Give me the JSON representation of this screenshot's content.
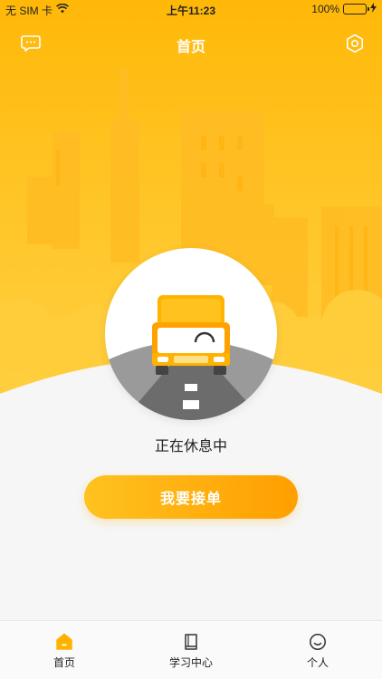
{
  "status_bar": {
    "carrier": "无 SIM 卡",
    "time": "上午11:23",
    "battery": "100%"
  },
  "nav": {
    "title": "首页",
    "left_icon": "message-icon",
    "right_icon": "settings-icon"
  },
  "main": {
    "status_text": "正在休息中",
    "order_button": "我要接单"
  },
  "tabs": [
    {
      "label": "首页",
      "icon": "home-icon",
      "active": true
    },
    {
      "label": "学习中心",
      "icon": "book-icon",
      "active": false
    },
    {
      "label": "个人",
      "icon": "smile-icon",
      "active": false
    }
  ],
  "colors": {
    "accent": "#ffb300",
    "hero_top": "#ffb808",
    "hero_bottom": "#ffd043",
    "battery": "#4cd964"
  }
}
